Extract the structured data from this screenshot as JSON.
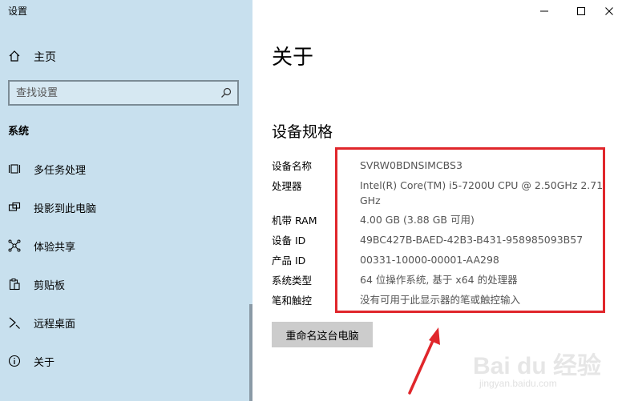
{
  "window": {
    "title": "设置"
  },
  "sidebar": {
    "home_label": "主页",
    "search_placeholder": "查找设置",
    "section_label": "系统",
    "items": [
      {
        "label": "多任务处理",
        "icon": "multitasking-icon"
      },
      {
        "label": "投影到此电脑",
        "icon": "projection-icon"
      },
      {
        "label": "体验共享",
        "icon": "share-icon"
      },
      {
        "label": "剪贴板",
        "icon": "clipboard-icon"
      },
      {
        "label": "远程桌面",
        "icon": "remote-desktop-icon"
      },
      {
        "label": "关于",
        "icon": "info-icon"
      }
    ]
  },
  "main": {
    "page_title": "关于",
    "section_title": "设备规格",
    "specs": [
      {
        "key": "设备名称",
        "value": "SVRW0BDNSIMCBS3"
      },
      {
        "key": "处理器",
        "value": "Intel(R) Core(TM) i5-7200U CPU @ 2.50GHz   2.71 GHz"
      },
      {
        "key": "机带 RAM",
        "value": "4.00 GB (3.88 GB 可用)"
      },
      {
        "key": "设备 ID",
        "value": "49BC427B-BAED-42B3-B431-958985093B57"
      },
      {
        "key": "产品 ID",
        "value": "00331-10000-00001-AA298"
      },
      {
        "key": "系统类型",
        "value": "64 位操作系统, 基于 x64 的处理器"
      },
      {
        "key": "笔和触控",
        "value": "没有可用于此显示器的笔或触控输入"
      }
    ],
    "rename_button": "重命名这台电脑"
  },
  "watermark": {
    "main": "Bai du 经验",
    "sub": "jingyan.baidu.com"
  },
  "colors": {
    "sidebar_bg": "#c8e0ee",
    "highlight": "#e0262b",
    "button_bg": "#cccccc"
  }
}
